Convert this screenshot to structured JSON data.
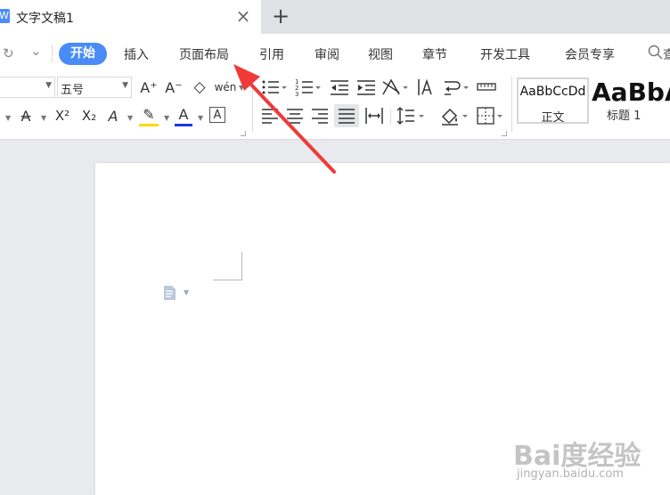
{
  "titlebar": {
    "app_logo": "W",
    "doc_title": "文字文稿1",
    "close_icon": "×",
    "new_tab_icon": "+"
  },
  "quick_access": {
    "redo_icon": "↻",
    "customize_icon": "⌄"
  },
  "menu": {
    "active": "开始",
    "items": [
      "插入",
      "页面布局",
      "引用",
      "审阅",
      "视图",
      "章节",
      "开发工具",
      "会员专享"
    ],
    "search_label": "查"
  },
  "font": {
    "size_value": "五号",
    "name_value": ""
  },
  "tools": {
    "grow_font": "A⁺",
    "shrink_font": "A⁻",
    "clear_format": "◇",
    "phonetic": "wén",
    "strike": "A",
    "superscript": "X²",
    "subscript": "X₂",
    "text_effect": "A",
    "highlight": "✎",
    "font_color": "A",
    "char_border": "A"
  },
  "styles": [
    {
      "sample": "AaBbCcDd",
      "label": "正文"
    },
    {
      "sample": "AaBbA",
      "label": "标题 1"
    }
  ],
  "colors": {
    "accent": "#4a8cf7",
    "highlight": "#ffd800",
    "font_color": "#1a37e6",
    "arrow": "#f03a3a"
  },
  "watermark": {
    "brand": "Bai度经验",
    "url": "jingyan.baidu.com"
  }
}
